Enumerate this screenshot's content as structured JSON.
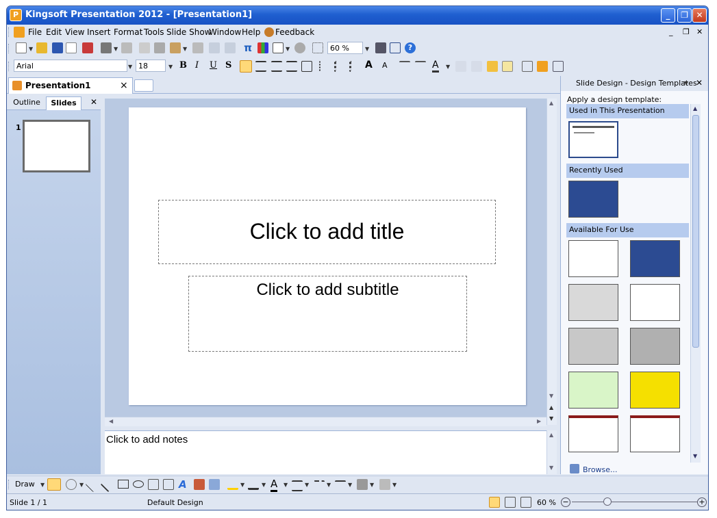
{
  "window": {
    "title": "Kingsoft Presentation 2012 - [Presentation1]",
    "app_icon_letter": "P",
    "controls": [
      "_",
      "❐",
      "✕"
    ]
  },
  "menubar": {
    "items": [
      "File",
      "Edit",
      "View",
      "Insert",
      "Format",
      "Tools",
      "Slide Show",
      "Window",
      "Help",
      "Feedback"
    ],
    "mdi_controls": [
      "_",
      "❐",
      "✕"
    ]
  },
  "toolbar": {
    "zoom": "60 %"
  },
  "format_toolbar": {
    "font": "Arial",
    "size": "18",
    "bold": "B",
    "italic": "I",
    "underline": "U",
    "shadow": "S"
  },
  "document_tab": {
    "label": "Presentation1",
    "close": "×"
  },
  "left_pane": {
    "tabs": [
      "Outline",
      "Slides"
    ],
    "close": "✕",
    "slide_number": "1"
  },
  "slide": {
    "title_placeholder": "Click to add title",
    "subtitle_placeholder": "Click to add subtitle"
  },
  "notes": {
    "placeholder": "Click to add notes"
  },
  "task_pane": {
    "title": "Slide Design - Design Templates",
    "close": "✕",
    "instruction": "Apply a design template:",
    "sections": [
      "Used in This Presentation",
      "Recently Used",
      "Available For Use"
    ],
    "browse": "Browse..."
  },
  "drawbar": {
    "draw_label": "Draw"
  },
  "status": {
    "slide": "Slide 1 / 1",
    "design": "Default Design",
    "zoom": "60 %"
  },
  "colors": {
    "title_bar": "#1f5fd0",
    "accent_blue": "#2b4a8c",
    "section_header": "#b6cbee"
  }
}
